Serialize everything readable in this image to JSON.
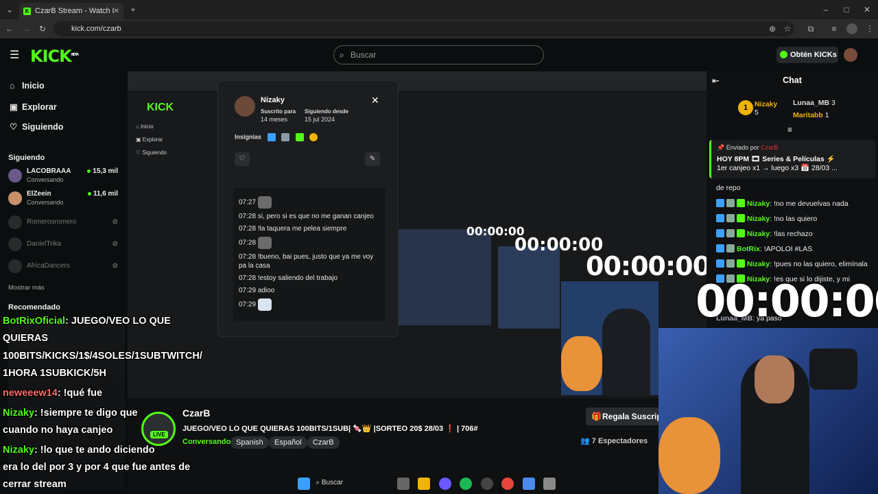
{
  "browser": {
    "tab_title": "CzarB Stream - Watch Live on K",
    "url": "kick.com/czarb",
    "new_tab": "+",
    "window_controls": [
      "–",
      "□",
      "✕"
    ]
  },
  "header": {
    "logo": "KICK",
    "logo_beta": "BETA",
    "search_placeholder": "Buscar",
    "kicks_button": "Obtén KICKs"
  },
  "sidebar": {
    "nav": [
      "Inicio",
      "Explorar",
      "Siguiendo"
    ],
    "following_title": "Siguiendo",
    "following": [
      {
        "name": "LACOBRAAA",
        "status": "Conversando",
        "viewers": "15,3 mil",
        "live": true
      },
      {
        "name": "ElZeein",
        "status": "Conversando",
        "viewers": "11,6 mil",
        "live": true
      },
      {
        "name": "Romerosromero",
        "live": false
      },
      {
        "name": "DanielTrika",
        "live": false
      },
      {
        "name": "AfricaDancers",
        "live": false
      }
    ],
    "show_more": "Mostrar más",
    "recommended_title": "Recomendado"
  },
  "popup": {
    "username": "Nizaky",
    "subscribed_label": "Suscrito para",
    "subscribed_value": "14 meses",
    "following_label": "Siguiendo desde",
    "following_value": "15 jul 2024",
    "badges_label": "Insignias",
    "close": "✕",
    "messages": [
      {
        "time": "07:27",
        "text": "",
        "emote": true
      },
      {
        "time": "07:28",
        "text": "si, pero si es que no me ganan canjeo",
        "emote": false
      },
      {
        "time": "07:28",
        "text": "!la taquera me pelea siempre",
        "emote": false
      },
      {
        "time": "07:28",
        "text": "",
        "emote": true
      },
      {
        "time": "07:28",
        "text": "!bueno, bai pues, justo que ya me voy pa la casa",
        "emote": false
      },
      {
        "time": "07:28",
        "text": "!estoy saliendo del trabajo",
        "emote": false
      },
      {
        "time": "07:29",
        "text": "adioo",
        "emote": false
      },
      {
        "time": "07:29",
        "text": "",
        "emote": true
      }
    ]
  },
  "overlay": {
    "l1_user": "BotRixOficial",
    "l1_text": ": JUEGO/VEO LO QUE",
    "l2": "QUIERAS",
    "l3": "100BITS/KICKS/1$/4SOLES/1SUBTWITCH/",
    "l4": "1HORA 1SUBKICK/5H",
    "l5_user": "neweeew14",
    "l5_text": ": !qué fue",
    "l6_user": "Nizaky",
    "l6_text": ": !siempre te digo que",
    "l7": "cuando no haya canjeo",
    "l8_user": "Nizaky",
    "l8_text": ": !lo que te ando diciendo",
    "l9": "era lo del por 3 y por 4 que fue antes de",
    "l10": "cerrar stream"
  },
  "channel": {
    "name": "CzarB",
    "title": "JUEGO/VEO LO QUE QUIERAS 100BITS/1SUB| 🍬👑 |SORTEO 20$ 28/03 ❗ | 706#",
    "category": "Conversando",
    "tags": [
      "Spanish",
      "Español",
      "CzarB"
    ],
    "live": "LIVE",
    "gift_button": "Regala Suscrip",
    "viewers": "7 Espectadores"
  },
  "chat": {
    "title": "Chat",
    "top": [
      {
        "name": "Nizaky",
        "count": "5"
      },
      {
        "name": "Lunaa_MB",
        "count": "3"
      },
      {
        "name": "Maritabb",
        "count": "1"
      }
    ],
    "pinned_by_label": "Enviado por",
    "pinned_by": "CzarB",
    "pinned_l1": "HOY 8PM 🎞 Series & Películas ⚡",
    "pinned_l2": "1er canjeo x1 → luego x3 📅 28/03 ...",
    "partial_msg": "de repo",
    "messages": [
      {
        "user": "Nizaky",
        "text": "!no me devuelvas nada"
      },
      {
        "user": "Nizaky",
        "text": "!no las quiero"
      },
      {
        "user": "Nizaky",
        "text": "!las rechazo"
      },
      {
        "user": "BotRix",
        "text": "!APOLOI #LAS"
      },
      {
        "user": "Nizaky",
        "text": "!pues no las quiero, elimínala"
      },
      {
        "user": "Nizaky",
        "text": "!es que si lo dijiste, y mi"
      }
    ],
    "last_user": "Lunaa_MB",
    "last_text": "ya paso"
  },
  "timer": "00:00:00",
  "taskbar": {
    "search": "Buscar"
  }
}
